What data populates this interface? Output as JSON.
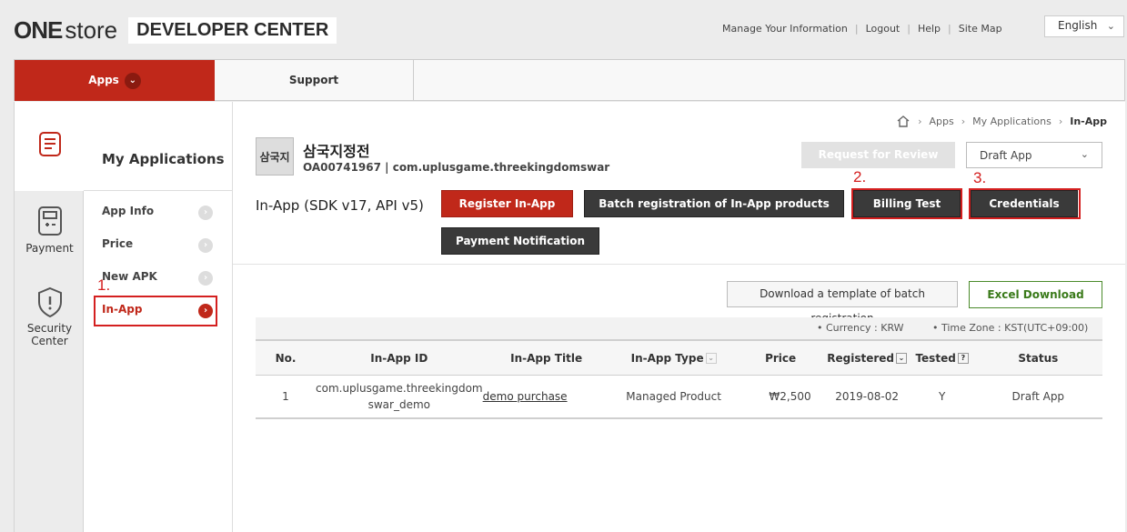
{
  "header": {
    "logo_one": "ONE",
    "logo_store": "store",
    "logo_dev": "DEVELOPER CENTER",
    "links": [
      "Manage Your Information",
      "Logout",
      "Help",
      "Site Map"
    ],
    "language": "English"
  },
  "nav": {
    "apps": "Apps",
    "support": "Support"
  },
  "icon_sidebar": {
    "payment": "Payment",
    "security_1": "Security",
    "security_2": "Center"
  },
  "sidebar": {
    "title": "My Applications",
    "items": [
      {
        "label": "App Info"
      },
      {
        "label": "Price"
      },
      {
        "label": "New APK"
      },
      {
        "label": "In-App"
      }
    ]
  },
  "breadcrumb": {
    "items": [
      "Apps",
      "My Applications",
      "In-App"
    ]
  },
  "app": {
    "thumb_text": "삼국지",
    "name": "삼국지정전",
    "id_line": "OA00741967 | com.uplusgame.threekingdomswar"
  },
  "actions": {
    "request_review": "Request for Review",
    "status_select": "Draft App"
  },
  "inapp": {
    "title": "In-App (SDK v17, API v5)",
    "buttons": {
      "register": "Register In-App",
      "batch": "Batch registration of In-App products",
      "billing_test": "Billing Test",
      "credentials": "Credentials",
      "payment_notification": "Payment Notification"
    }
  },
  "annotations": {
    "step1": "1.",
    "step2": "2.",
    "step3": "3."
  },
  "downloads": {
    "template": "Download a template of batch registration",
    "excel": "Excel Download"
  },
  "meta": {
    "currency": "• Currency : KRW",
    "timezone": "• Time Zone : KST(UTC+09:00)"
  },
  "table": {
    "headers": [
      "No.",
      "In-App ID",
      "In-App Title",
      "In-App Type",
      "Price",
      "Registered",
      "Tested",
      "Status"
    ],
    "rows": [
      {
        "no": "1",
        "id_1": "com.uplusgame.threekingdom",
        "id_2": "swar_demo",
        "title": "demo purchase",
        "type": "Managed Product",
        "price": "₩2,500",
        "registered": "2019-08-02",
        "tested": "Y",
        "status": "Draft App"
      }
    ]
  },
  "colors": {
    "accent": "#c0281a",
    "dark_button": "#3a3a3a",
    "excel_green": "#3a7a1a",
    "annotation": "#d42020"
  }
}
